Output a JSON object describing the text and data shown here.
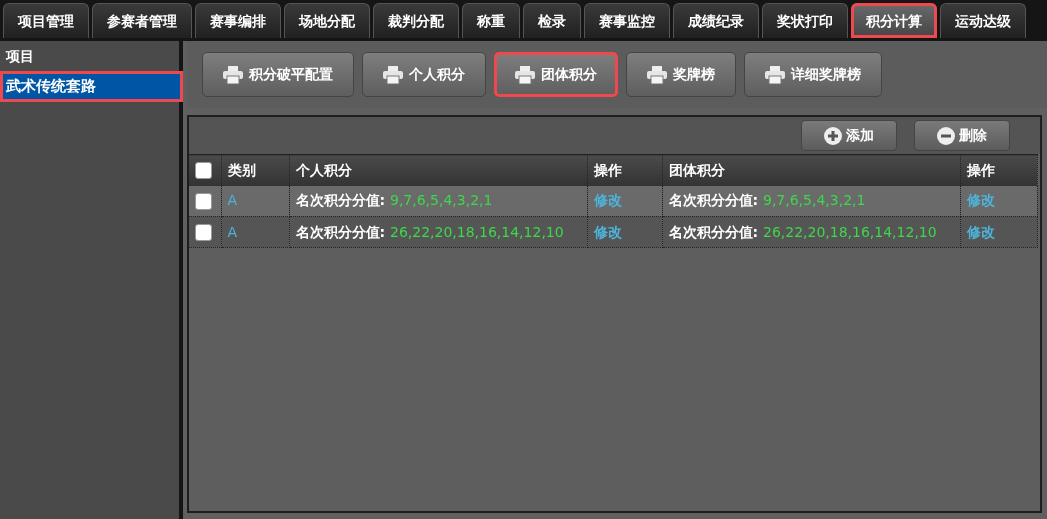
{
  "tabs": [
    {
      "label": "项目管理",
      "selected": false,
      "highlighted": false
    },
    {
      "label": "参赛者管理",
      "selected": false,
      "highlighted": false
    },
    {
      "label": "赛事编排",
      "selected": false,
      "highlighted": false
    },
    {
      "label": "场地分配",
      "selected": false,
      "highlighted": false
    },
    {
      "label": "裁判分配",
      "selected": false,
      "highlighted": false
    },
    {
      "label": "称重",
      "selected": false,
      "highlighted": false
    },
    {
      "label": "检录",
      "selected": false,
      "highlighted": false
    },
    {
      "label": "赛事监控",
      "selected": false,
      "highlighted": false
    },
    {
      "label": "成绩纪录",
      "selected": false,
      "highlighted": false
    },
    {
      "label": "奖状打印",
      "selected": false,
      "highlighted": false
    },
    {
      "label": "积分计算",
      "selected": true,
      "highlighted": true
    },
    {
      "label": "运动达级",
      "selected": false,
      "highlighted": false
    }
  ],
  "sidebar": {
    "title": "项目",
    "items": [
      {
        "label": "武术传统套路",
        "selected": true,
        "highlighted": true
      }
    ]
  },
  "toolbar": [
    {
      "label": "积分破平配置",
      "highlighted": false
    },
    {
      "label": "个人积分",
      "highlighted": false
    },
    {
      "label": "团体积分",
      "highlighted": true
    },
    {
      "label": "奖牌榜",
      "highlighted": false
    },
    {
      "label": "详细奖牌榜",
      "highlighted": false
    }
  ],
  "grid_actions": [
    {
      "kind": "add",
      "label": "添加"
    },
    {
      "kind": "remove",
      "label": "删除"
    }
  ],
  "table": {
    "select_all": {
      "checked": false
    },
    "columns": [
      "类别",
      "个人积分",
      "操作",
      "团体积分",
      "操作"
    ],
    "rows": [
      {
        "checked": false,
        "category": "A",
        "individual_label": "名次积分分值:",
        "individual_value": "9,7,6,5,4,3,2,1",
        "individual_action": "修改",
        "team_label": "名次积分分值:",
        "team_value": "9,7,6,5,4,3,2,1",
        "team_action": "修改"
      },
      {
        "checked": false,
        "category": "A",
        "individual_label": "名次积分分值:",
        "individual_value": "26,22,20,18,16,14,12,10",
        "individual_action": "修改",
        "team_label": "名次积分分值:",
        "team_value": "26,22,20,18,16,14,12,10",
        "team_action": "修改"
      }
    ]
  }
}
